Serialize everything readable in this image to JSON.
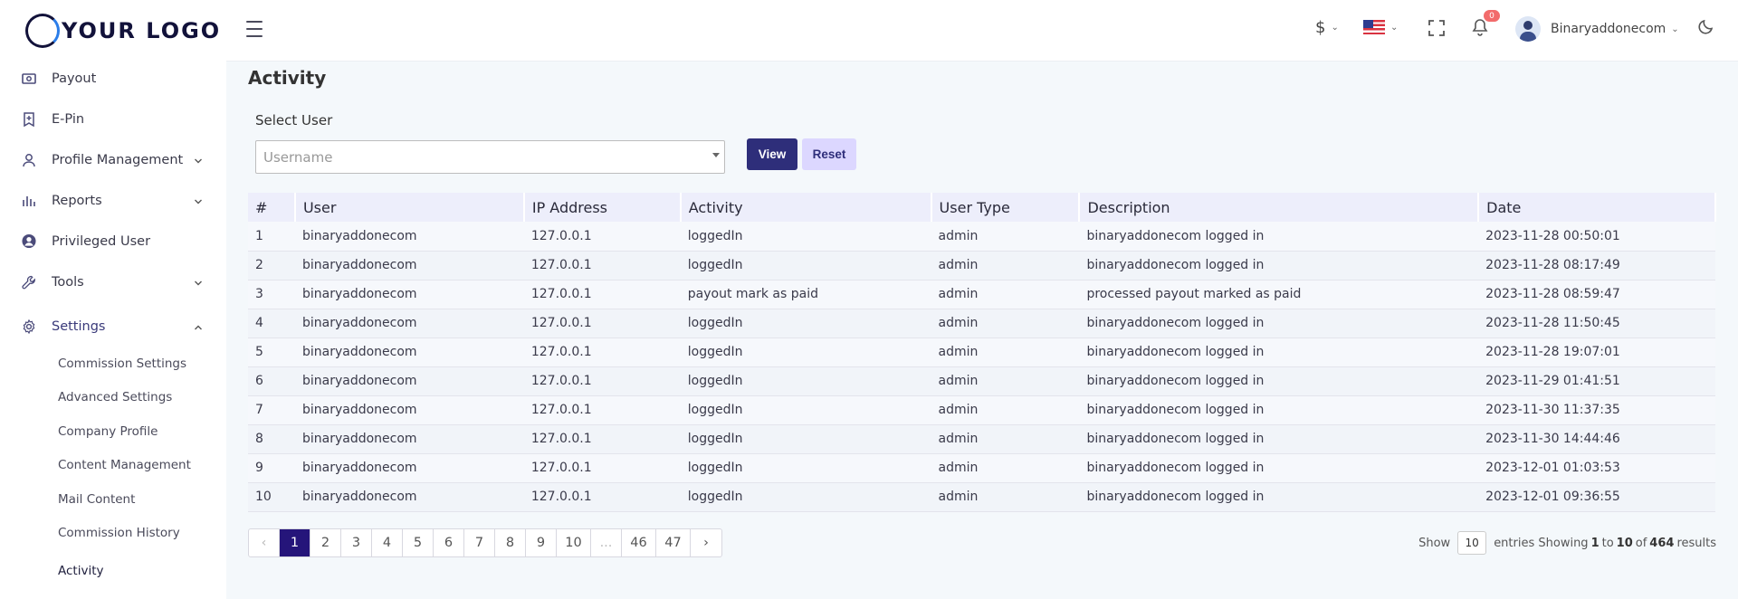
{
  "logo": {
    "text": "YOUR LOGO"
  },
  "sidebar": {
    "items": [
      {
        "label": "Payout",
        "icon": "payout-icon"
      },
      {
        "label": "E-Pin",
        "icon": "epin-icon"
      },
      {
        "label": "Profile Management",
        "icon": "user-icon",
        "expandable": true
      },
      {
        "label": "Reports",
        "icon": "bar-chart-icon",
        "expandable": true
      },
      {
        "label": "Privileged User",
        "icon": "user-circle-icon"
      },
      {
        "label": "Tools",
        "icon": "wrench-icon",
        "expandable": true
      },
      {
        "label": "Settings",
        "icon": "gear-icon",
        "expandable": true,
        "expanded": true
      }
    ],
    "settings_sub": [
      "Commission Settings",
      "Advanced Settings",
      "Company Profile",
      "Content Management",
      "Mail Content",
      "Commission History",
      "Activity"
    ],
    "active_sub": "Activity"
  },
  "header": {
    "currency": "$",
    "notifications_count": "0",
    "username": "Binaryaddonecom"
  },
  "page": {
    "title": "Activity",
    "select_label": "Select User",
    "select_placeholder": "Username",
    "view_button": "View",
    "reset_button": "Reset"
  },
  "table": {
    "headers": [
      "#",
      "User",
      "IP Address",
      "Activity",
      "User Type",
      "Description",
      "Date"
    ],
    "rows": [
      [
        "1",
        "binaryaddonecom",
        "127.0.0.1",
        "loggedIn",
        "admin",
        "binaryaddonecom logged in",
        "2023-11-28 00:50:01"
      ],
      [
        "2",
        "binaryaddonecom",
        "127.0.0.1",
        "loggedIn",
        "admin",
        "binaryaddonecom logged in",
        "2023-11-28 08:17:49"
      ],
      [
        "3",
        "binaryaddonecom",
        "127.0.0.1",
        "payout mark as paid",
        "admin",
        "processed payout marked as paid",
        "2023-11-28 08:59:47"
      ],
      [
        "4",
        "binaryaddonecom",
        "127.0.0.1",
        "loggedIn",
        "admin",
        "binaryaddonecom logged in",
        "2023-11-28 11:50:45"
      ],
      [
        "5",
        "binaryaddonecom",
        "127.0.0.1",
        "loggedIn",
        "admin",
        "binaryaddonecom logged in",
        "2023-11-28 19:07:01"
      ],
      [
        "6",
        "binaryaddonecom",
        "127.0.0.1",
        "loggedIn",
        "admin",
        "binaryaddonecom logged in",
        "2023-11-29 01:41:51"
      ],
      [
        "7",
        "binaryaddonecom",
        "127.0.0.1",
        "loggedIn",
        "admin",
        "binaryaddonecom logged in",
        "2023-11-30 11:37:35"
      ],
      [
        "8",
        "binaryaddonecom",
        "127.0.0.1",
        "loggedIn",
        "admin",
        "binaryaddonecom logged in",
        "2023-11-30 14:44:46"
      ],
      [
        "9",
        "binaryaddonecom",
        "127.0.0.1",
        "loggedIn",
        "admin",
        "binaryaddonecom logged in",
        "2023-12-01 01:03:53"
      ],
      [
        "10",
        "binaryaddonecom",
        "127.0.0.1",
        "loggedIn",
        "admin",
        "binaryaddonecom logged in",
        "2023-12-01 09:36:55"
      ]
    ]
  },
  "pagination": {
    "pages": [
      "1",
      "2",
      "3",
      "4",
      "5",
      "6",
      "7",
      "8",
      "9",
      "10",
      "...",
      "46",
      "47"
    ],
    "current": "1",
    "prev": "‹",
    "next": "›"
  },
  "entries": {
    "show_label": "Show",
    "per_page": "10",
    "prefix": "entries Showing",
    "from": "1",
    "to_word": "to",
    "to": "10",
    "of_word": "of",
    "total": "464",
    "suffix": "results"
  },
  "colors": {
    "primary": "#2e2e7a",
    "active_page": "#25157a",
    "reset_bg": "#dcd7ff",
    "badge": "#f26b6b",
    "table_header_bg": "#edeefb"
  }
}
